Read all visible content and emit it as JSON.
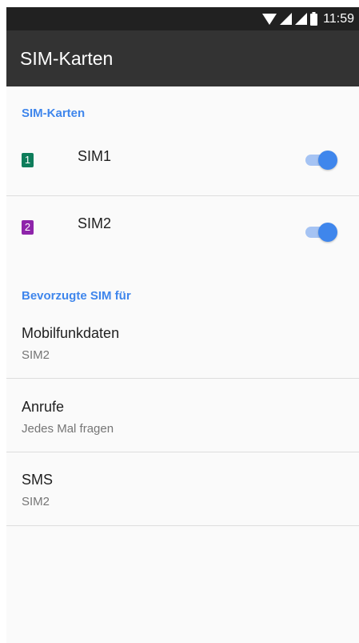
{
  "status_bar": {
    "time": "11:59",
    "icons": [
      "wifi-icon",
      "signal-icon",
      "signal-icon",
      "battery-icon"
    ]
  },
  "app_bar": {
    "title": "SIM-Karten"
  },
  "sim_section": {
    "header": "SIM-Karten",
    "sims": [
      {
        "name": "SIM1",
        "slot": "1",
        "color": "#0e7d5b",
        "enabled": true
      },
      {
        "name": "SIM2",
        "slot": "2",
        "color": "#8e24aa",
        "enabled": true
      }
    ]
  },
  "preferred_section": {
    "header": "Bevorzugte SIM für",
    "items": [
      {
        "title": "Mobilfunkdaten",
        "value": "SIM2"
      },
      {
        "title": "Anrufe",
        "value": "Jedes Mal fragen"
      },
      {
        "title": "SMS",
        "value": "SIM2"
      }
    ]
  },
  "colors": {
    "accent": "#3f86ec",
    "app_bar": "#333333",
    "status_bar": "#212121"
  }
}
